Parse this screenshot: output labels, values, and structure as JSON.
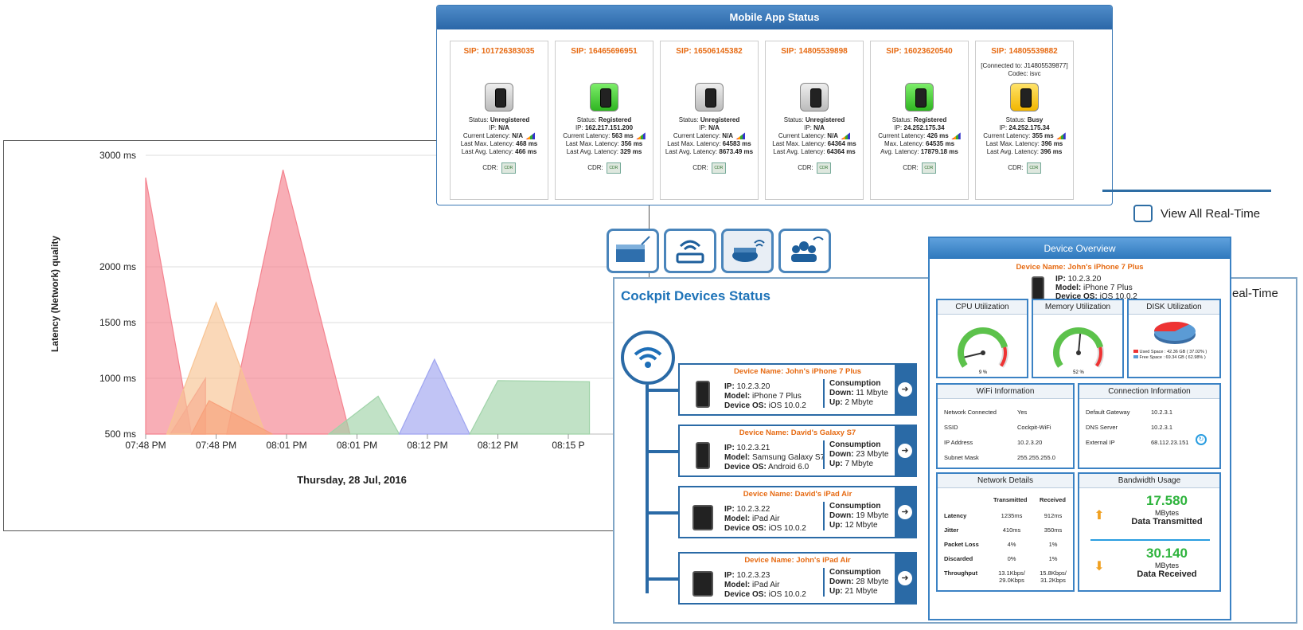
{
  "mobile_status": {
    "title": "Mobile App Status",
    "cards": [
      {
        "sip": "SIP: 101726383035",
        "connected": "",
        "codec": "",
        "status_color": "gray",
        "status_label": "Status:",
        "status": "Unregistered",
        "ip_label": "IP:",
        "ip": "N/A",
        "lat_label": "Current Latency:",
        "latency": "N/A",
        "max_label": "Last Max. Latency:",
        "max": "468 ms",
        "avg_label": "Last Avg. Latency:",
        "avg": "466 ms",
        "cdr_label": "CDR:"
      },
      {
        "sip": "SIP: 16465696951",
        "connected": "",
        "codec": "",
        "status_color": "green",
        "status_label": "Status:",
        "status": "Registered",
        "ip_label": "IP:",
        "ip": "162.217.151.200",
        "lat_label": "Current Latency:",
        "latency": "563 ms",
        "max_label": "Last Max. Latency:",
        "max": "356 ms",
        "avg_label": "Last Avg. Latency:",
        "avg": "329 ms",
        "cdr_label": "CDR:"
      },
      {
        "sip": "SIP: 16506145382",
        "connected": "",
        "codec": "",
        "status_color": "gray",
        "status_label": "Status:",
        "status": "Unregistered",
        "ip_label": "IP:",
        "ip": "N/A",
        "lat_label": "Current Latency:",
        "latency": "N/A",
        "max_label": "Last Max. Latency:",
        "max": "64583 ms",
        "avg_label": "Last Avg. Latency:",
        "avg": "8673.49 ms",
        "cdr_label": "CDR:"
      },
      {
        "sip": "SIP: 14805539898",
        "connected": "",
        "codec": "",
        "status_color": "gray",
        "status_label": "Status:",
        "status": "Unregistered",
        "ip_label": "IP:",
        "ip": "N/A",
        "lat_label": "Current Latency:",
        "latency": "N/A",
        "max_label": "Last Max. Latency:",
        "max": "64364 ms",
        "avg_label": "Last Avg. Latency:",
        "avg": "64364 ms",
        "cdr_label": "CDR:"
      },
      {
        "sip": "SIP: 16023620540",
        "connected": "",
        "codec": "",
        "status_color": "green",
        "status_label": "Status:",
        "status": "Registered",
        "ip_label": "IP:",
        "ip": "24.252.175.34",
        "lat_label": "Current Latency:",
        "latency": "426 ms",
        "max_label": "Max. Latency:",
        "max": "64535 ms",
        "avg_label": "Avg. Latency:",
        "avg": "17879.18 ms",
        "cdr_label": "CDR:"
      },
      {
        "sip": "SIP: 14805539882",
        "connected": "[Connected to: J14805539877]",
        "codec": "Codec: isvc",
        "status_color": "yellow",
        "status_label": "Status:",
        "status": "Busy",
        "ip_label": "IP:",
        "ip": "24.252.175.34",
        "lat_label": "Current Latency:",
        "latency": "355 ms",
        "max_label": "Last Max. Latency:",
        "max": "396 ms",
        "avg_label": "Last Avg. Latency:",
        "avg": "396 ms",
        "cdr_label": "CDR:"
      }
    ],
    "cdr_icon_text": "CDR"
  },
  "view_all": {
    "label": "View All Real-Time"
  },
  "real_time_fragment": "eal-Time",
  "chart_data": {
    "type": "area",
    "ylabel": "Latency (Network) quality",
    "xlabel": "Thursday, 28 Jul, 2016",
    "y_ticks": [
      "500 ms",
      "1000 ms",
      "1500 ms",
      "2000 ms",
      "3000 ms"
    ],
    "x_ticks": [
      "07:48 PM",
      "07:48 PM",
      "08:01 PM",
      "08:01 PM",
      "08:12 PM",
      "08:12 PM",
      "08:15 P"
    ],
    "series": [
      {
        "color": "#f4838f",
        "points": [
          [
            0,
            2800
          ],
          [
            0.65,
            500
          ]
        ]
      },
      {
        "color": "#f4838f",
        "points": [
          [
            0.35,
            500
          ],
          [
            0.85,
            1000
          ]
        ]
      },
      {
        "color": "#f4838f",
        "points": [
          [
            1.15,
            500
          ],
          [
            1.95,
            2870
          ],
          [
            2.9,
            500
          ]
        ]
      },
      {
        "color": "#f8c392",
        "points": [
          [
            0.3,
            500
          ],
          [
            1.0,
            1680
          ],
          [
            1.7,
            500
          ]
        ]
      },
      {
        "color": "#f8a07a",
        "points": [
          [
            0.65,
            500
          ],
          [
            0.9,
            800
          ],
          [
            1.8,
            500
          ]
        ]
      },
      {
        "color": "#9fd3a8",
        "points": [
          [
            2.6,
            500
          ],
          [
            3.3,
            840
          ],
          [
            3.6,
            500
          ]
        ]
      },
      {
        "color": "#9fa5f0",
        "points": [
          [
            3.6,
            500
          ],
          [
            4.1,
            1170
          ],
          [
            4.6,
            500
          ]
        ]
      },
      {
        "color": "#9fd3a8",
        "points": [
          [
            4.6,
            500
          ],
          [
            5.0,
            980
          ],
          [
            6.3,
            970
          ]
        ]
      }
    ]
  },
  "cockpit": {
    "title": "Cockpit Devices Status",
    "devices": [
      {
        "name": "Device Name: John's iPhone 7 Plus",
        "ip_label": "IP:",
        "ip": "10.2.3.20",
        "model_label": "Model:",
        "model": "iPhone 7 Plus",
        "os_label": "Device OS:",
        "os": "iOS 10.0.2",
        "cons_label": "Consumption",
        "down_label": "Down:",
        "down": "11 Mbyte",
        "up_label": "Up:",
        "up": "2 Mbyte",
        "kind": "phone"
      },
      {
        "name": "Device Name: David's Galaxy S7",
        "ip_label": "IP:",
        "ip": "10.2.3.21",
        "model_label": "Model:",
        "model": "Samsung Galaxy S7",
        "os_label": "Device OS:",
        "os": "Android 6.0",
        "cons_label": "Consumption",
        "down_label": "Down:",
        "down": "23 Mbyte",
        "up_label": "Up:",
        "up": "7 Mbyte",
        "kind": "phone"
      },
      {
        "name": "Device Name: David's iPad Air",
        "ip_label": "IP:",
        "ip": "10.2.3.22",
        "model_label": "Model:",
        "model": "iPad Air",
        "os_label": "Device OS:",
        "os": "iOS 10.0.2",
        "cons_label": "Consumption",
        "down_label": "Down:",
        "down": "19 Mbyte",
        "up_label": "Up:",
        "up": "12 Mbyte",
        "kind": "tablet"
      },
      {
        "name": "Device Name: John's iPad Air",
        "ip_label": "IP:",
        "ip": "10.2.3.23",
        "model_label": "Model:",
        "model": "iPad Air",
        "os_label": "Device OS:",
        "os": "iOS 10.0.2",
        "cons_label": "Consumption",
        "down_label": "Down:",
        "down": "28 Mbyte",
        "up_label": "Up:",
        "up": "21 Mbyte",
        "kind": "tablet"
      }
    ]
  },
  "overview": {
    "title": "Device Overview",
    "device_name": "Device Name: John's iPhone 7 Plus",
    "ip_label": "IP:",
    "ip": "10.2.3.20",
    "model_label": "Model:",
    "model": "iPhone 7 Plus",
    "os_label": "Device OS:",
    "os": "iOS 10.0.2",
    "cpu": {
      "title": "CPU Utilization",
      "value": "9 %",
      "fraction": 0.09
    },
    "memory": {
      "title": "Memory Utilization",
      "value": "52 %",
      "fraction": 0.52
    },
    "disk": {
      "title": "DISK Utilization",
      "used": "Used Space : 42.36 GB ( 37.02% )",
      "free": "Free Space : 69.34 GB ( 62.98% )",
      "used_fraction": 0.3702
    },
    "wifi": {
      "title": "WiFi Information",
      "rows": [
        [
          "Network Connected",
          "Yes"
        ],
        [
          "SSID",
          "Cockpit-WiFi"
        ],
        [
          "IP Address",
          "10.2.3.20"
        ],
        [
          "Subnet Mask",
          "255.255.255.0"
        ]
      ]
    },
    "connection": {
      "title": "Connection Information",
      "rows": [
        [
          "Default Gateway",
          "10.2.3.1"
        ],
        [
          "DNS Server",
          "10.2.3.1"
        ],
        [
          "External IP",
          "68.112.23.151"
        ]
      ]
    },
    "network": {
      "title": "Network Details",
      "col1": "Transmitted",
      "col2": "Received",
      "rows": [
        [
          "Latency",
          "1235ms",
          "912ms"
        ],
        [
          "Jitter",
          "410ms",
          "350ms"
        ],
        [
          "Packet Loss",
          "4%",
          "1%"
        ],
        [
          "Discarded",
          "0%",
          "1%"
        ],
        [
          "Throughput",
          "13.1Kbps/ 29.0Kbps",
          "15.8Kbps/ 31.2Kbps"
        ]
      ]
    },
    "bandwidth": {
      "title": "Bandwidth Usage",
      "tx": "17.580",
      "tx_unit": "MBytes",
      "tx_label": "Data Transmitted",
      "rx": "30.140",
      "rx_unit": "MBytes",
      "rx_label": "Data Received"
    }
  }
}
